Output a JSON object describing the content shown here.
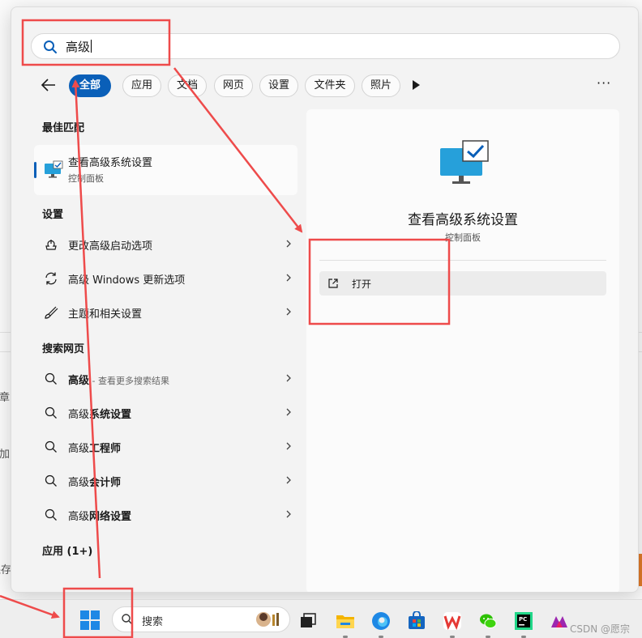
{
  "search": {
    "query": "高级"
  },
  "filters": {
    "back_label": "←",
    "chips": [
      "全部",
      "应用",
      "文档",
      "网页",
      "设置",
      "文件夹",
      "照片"
    ],
    "more": "···"
  },
  "best_match": {
    "title": "最佳匹配",
    "item": {
      "name": "查看高级系统设置",
      "category": "控制面板"
    }
  },
  "settings": {
    "title": "设置",
    "items": [
      {
        "label": "更改高级启动选项",
        "icon": "startup-icon"
      },
      {
        "label": "高级 Windows 更新选项",
        "icon": "refresh-icon"
      },
      {
        "label": "主题和相关设置",
        "icon": "brush-icon"
      }
    ]
  },
  "web": {
    "title": "搜索网页",
    "items": [
      {
        "bold": "高级",
        "rest": "",
        "sub": " - 查看更多搜索结果"
      },
      {
        "bold": "高级",
        "rest": "系统设置",
        "sub": ""
      },
      {
        "bold": "高级",
        "rest": "工程师",
        "sub": ""
      },
      {
        "bold": "高级",
        "rest": "会计师",
        "sub": ""
      },
      {
        "bold": "高级",
        "rest": "网络设置",
        "sub": ""
      }
    ]
  },
  "apps": {
    "title": "应用 (1+)"
  },
  "preview": {
    "name": "查看高级系统设置",
    "category": "控制面板",
    "open_label": "打开"
  },
  "background": {
    "fragment1": "文章",
    "fragment2": "添加",
    "fragment3": "保存"
  },
  "taskbar": {
    "search_label": "搜索",
    "apps": [
      "task-view-icon",
      "file-explorer-icon",
      "edge-icon",
      "store-icon",
      "wps-icon",
      "wechat-icon",
      "pycharm-icon",
      "clip-icon"
    ]
  },
  "watermark": "CSDN @愿宗",
  "colors": {
    "accent": "#0a5fb8",
    "annotation": "#ee4b4b"
  }
}
